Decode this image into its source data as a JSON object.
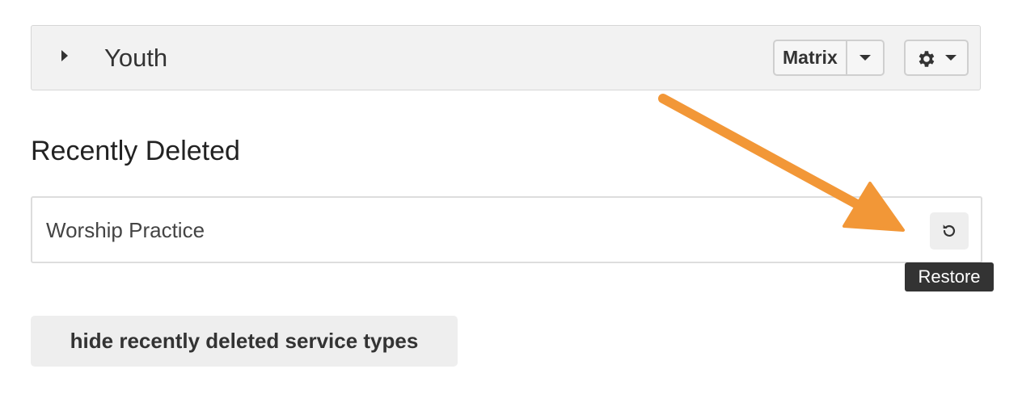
{
  "folder": {
    "name": "Youth",
    "view_label": "Matrix"
  },
  "recently_deleted": {
    "title": "Recently Deleted",
    "items": [
      {
        "name": "Worship Practice"
      }
    ],
    "restore_tooltip": "Restore"
  },
  "hide_button_label": "hide recently deleted service types",
  "annotation": {
    "arrow_color": "#f29737"
  },
  "icons": {
    "expand": "caret-right-icon",
    "dropdown": "caret-down-icon",
    "settings": "gear-icon",
    "restore": "restore-icon"
  }
}
